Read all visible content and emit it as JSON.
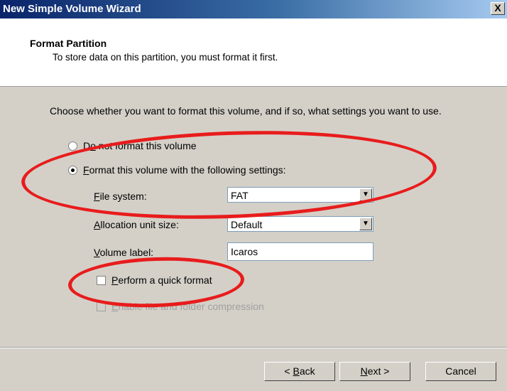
{
  "window": {
    "title": "New Simple Volume Wizard",
    "close_label": "X"
  },
  "header": {
    "title": "Format Partition",
    "subtitle": "To store data on this partition, you must format it first."
  },
  "main": {
    "intro": "Choose whether you want to format this volume, and if so, what settings you want to use.",
    "radio_no_format": {
      "pre": "D",
      "access": "o",
      "post": " not format this volume",
      "selected": false
    },
    "radio_format": {
      "access": "F",
      "post": "ormat this volume with the following settings:",
      "selected": true
    },
    "file_system": {
      "access": "F",
      "rest": "ile system:",
      "value": "FAT"
    },
    "allocation": {
      "access": "A",
      "rest": "llocation unit size:",
      "value": "Default"
    },
    "volume_label": {
      "access": "V",
      "rest": "olume label:",
      "value": "Icaros"
    },
    "quick_format": {
      "access": "P",
      "rest": "erform a quick format",
      "checked": false
    },
    "compression": {
      "access": "E",
      "rest": "nable file and folder compression",
      "checked": false,
      "enabled": false
    }
  },
  "buttons": {
    "back": {
      "pre": "< ",
      "access": "B",
      "rest": "ack"
    },
    "next": {
      "access": "N",
      "rest": "ext >"
    },
    "cancel": "Cancel"
  },
  "annotation_color": "#e81c1c"
}
